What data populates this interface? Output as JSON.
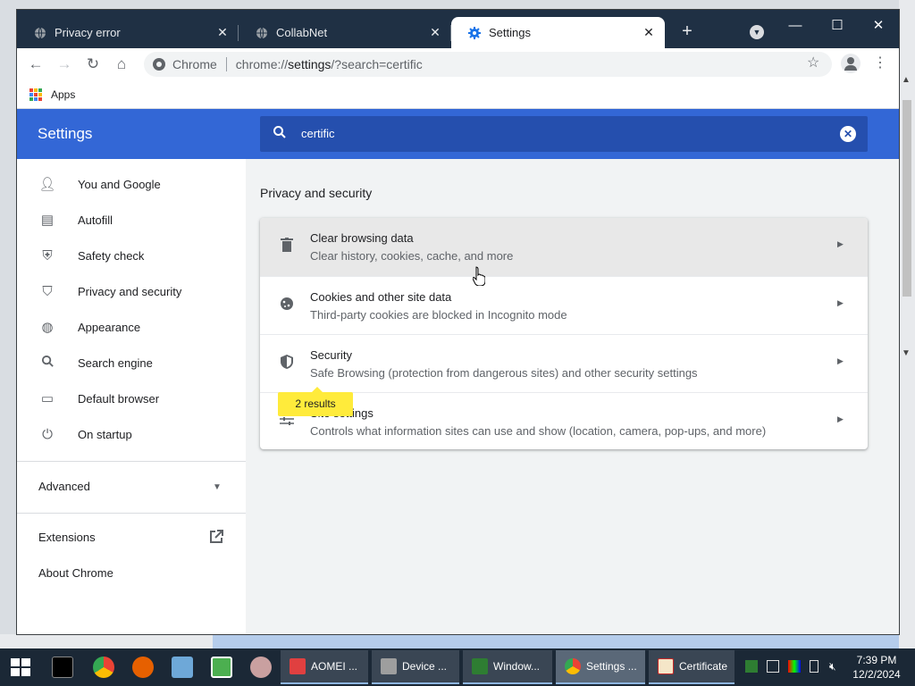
{
  "tabs": [
    {
      "title": "Privacy error",
      "icon": "globe-icon"
    },
    {
      "title": "CollabNet",
      "icon": "globe-icon"
    },
    {
      "title": "Settings",
      "icon": "gear-icon",
      "active": true
    }
  ],
  "omnibox": {
    "scheme_label": "Chrome",
    "url_prefix": "chrome://",
    "url_host": "settings",
    "url_rest": "/?search=certific"
  },
  "bookmarks": {
    "apps_label": "Apps"
  },
  "settings": {
    "title": "Settings",
    "search_value": "certific",
    "nav": [
      {
        "label": "You and Google",
        "icon": "person-icon"
      },
      {
        "label": "Autofill",
        "icon": "clipboard-icon"
      },
      {
        "label": "Safety check",
        "icon": "shield-check-icon"
      },
      {
        "label": "Privacy and security",
        "icon": "shield-icon"
      },
      {
        "label": "Appearance",
        "icon": "palette-icon"
      },
      {
        "label": "Search engine",
        "icon": "search-icon"
      },
      {
        "label": "Default browser",
        "icon": "browser-icon"
      },
      {
        "label": "On startup",
        "icon": "power-icon"
      }
    ],
    "advanced_label": "Advanced",
    "extensions_label": "Extensions",
    "about_label": "About Chrome",
    "section_title": "Privacy and security",
    "rows": [
      {
        "title": "Clear browsing data",
        "subtitle": "Clear history, cookies, cache, and more",
        "icon": "trash-icon"
      },
      {
        "title": "Cookies and other site data",
        "subtitle": "Third-party cookies are blocked in Incognito mode",
        "icon": "cookie-icon"
      },
      {
        "title": "Security",
        "subtitle": "Safe Browsing (protection from dangerous sites) and other security settings",
        "icon": "shield-icon"
      },
      {
        "title": "Site settings",
        "subtitle": "Controls what information sites can use and show (location, camera, pop-ups, and more)",
        "icon": "sliders-icon"
      }
    ],
    "results_bubble": "2 results"
  },
  "taskbar": {
    "buttons": [
      {
        "label": "AOMEI ..."
      },
      {
        "label": "Device ..."
      },
      {
        "label": "Window..."
      },
      {
        "label": "Settings ..."
      },
      {
        "label": "Certificate"
      }
    ],
    "time": "7:39 PM",
    "date": "12/2/2024"
  },
  "colors": {
    "accent": "#3367d6",
    "search_bg": "#254fae",
    "highlight": "#ffeb3b",
    "tabstrip": "#1f3044"
  }
}
